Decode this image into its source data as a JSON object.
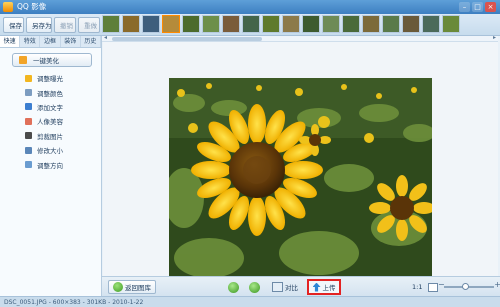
{
  "app": {
    "title": "QQ 影像"
  },
  "window_controls": {
    "minimize": "–",
    "maximize": "□",
    "close": "×"
  },
  "toolbar": {
    "save_label": "保存",
    "saveas_label": "另存为",
    "undo_label": "撤销",
    "redo_label": "重做"
  },
  "filmstrip": {
    "thumbnail_count": 18,
    "selected_index": 3
  },
  "left_panel": {
    "tabs": [
      {
        "label": "快速",
        "active": true
      },
      {
        "label": "特效",
        "active": false
      },
      {
        "label": "边框",
        "active": false
      },
      {
        "label": "装饰",
        "active": false
      },
      {
        "label": "历史",
        "active": false
      }
    ],
    "onekey_label": "一键美化",
    "items": [
      {
        "label": "调整曝光",
        "icon": "bulb-icon",
        "color": "#f2b620"
      },
      {
        "label": "调整颜色",
        "icon": "palette-icon",
        "color": "#7c9cc0"
      },
      {
        "label": "添加文字",
        "icon": "text-icon",
        "color": "#3b7ed0"
      },
      {
        "label": "人像美容",
        "icon": "portrait-icon",
        "color": "#e0705a"
      },
      {
        "label": "剪裁图片",
        "icon": "crop-icon",
        "color": "#4b4b4b"
      },
      {
        "label": "修改大小",
        "icon": "resize-icon",
        "color": "#5a86b8"
      },
      {
        "label": "调整方向",
        "icon": "rotate-icon",
        "color": "#6a9cd0"
      }
    ]
  },
  "bottombar": {
    "return_label": "返回图库",
    "compare_label": "对比",
    "upload_label": "上传",
    "zoom_label": "1:1"
  },
  "statusbar": {
    "text": "DSC_0051.JPG - 600×383 - 301KB - 2010-1-22"
  },
  "colors": {
    "accent": "#3d7fc1",
    "upload_highlight": "#e32222"
  }
}
